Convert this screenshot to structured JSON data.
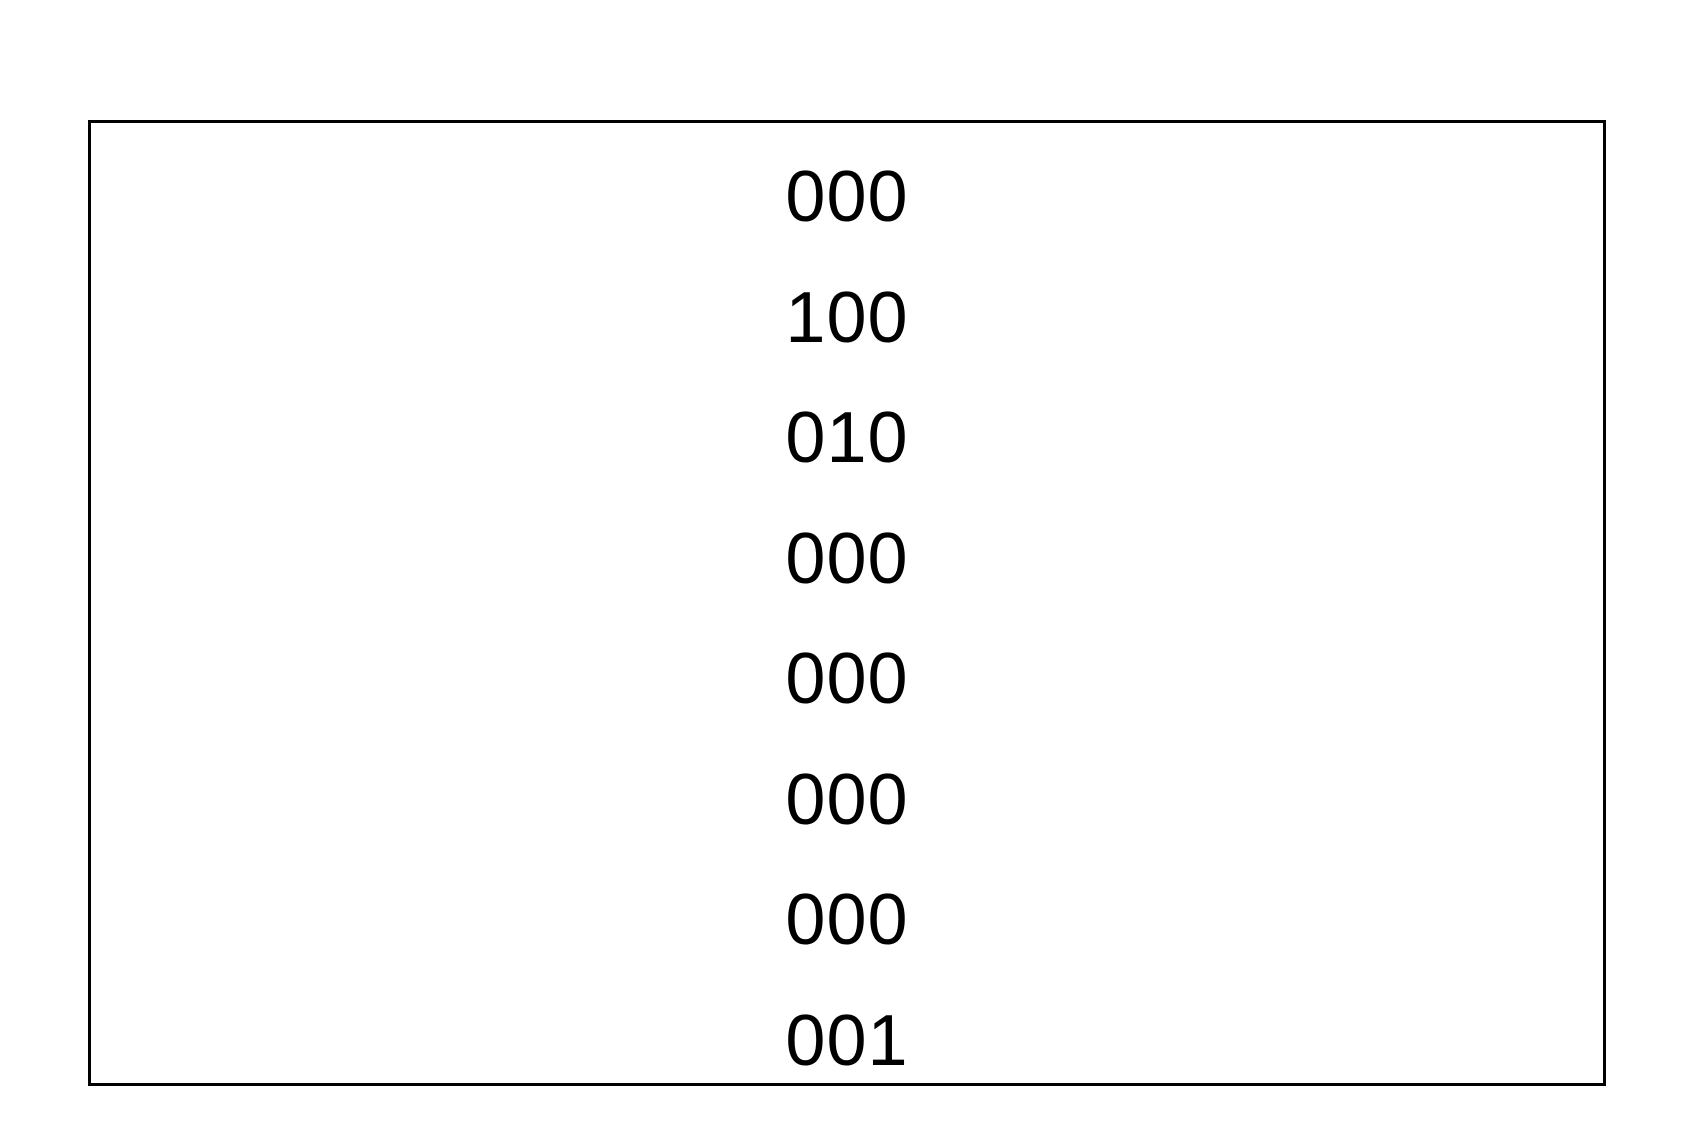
{
  "codes": [
    "000",
    "100",
    "010",
    "000",
    "000",
    "000",
    "000",
    "001"
  ]
}
